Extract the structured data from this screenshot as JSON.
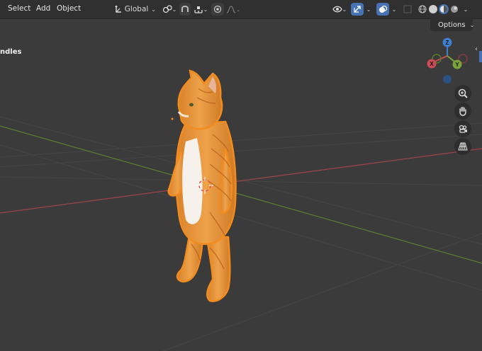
{
  "header": {
    "menus": [
      "Select",
      "Add",
      "Object"
    ],
    "transform_orientation": "Global",
    "options_label": "Options"
  },
  "viewport": {
    "overlay_text": "ndles",
    "gizmo": {
      "z": "Z",
      "x": "X",
      "y": "Y"
    },
    "scene_object": "orange tabby cat standing upright (selected mesh)"
  },
  "colors": {
    "x_axis": "#c94c57",
    "y_axis": "#7aa33a",
    "z_axis": "#3f7fd0",
    "selection_outline": "#f28c1e",
    "active_button": "#4772b3"
  },
  "icons": [
    "transform-orientation-icon",
    "pivot-icon",
    "snap-icon",
    "snap-target-icon",
    "proportional-edit-icon",
    "falloff-icon",
    "visibility-icon",
    "gizmo-icon",
    "overlay-icon",
    "xray-icon",
    "wireframe-icon",
    "solid-icon",
    "material-preview-icon",
    "rendered-icon",
    "zoom-icon",
    "pan-icon",
    "camera-view-icon",
    "ortho-grid-icon"
  ]
}
